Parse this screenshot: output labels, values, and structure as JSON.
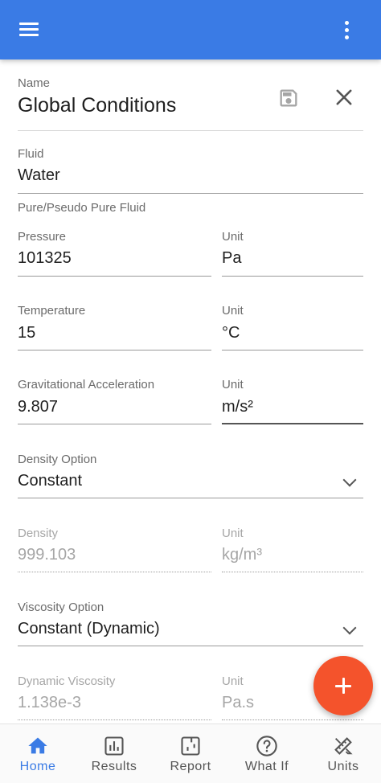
{
  "appbar": {
    "menu_icon": "hamburger-menu-icon",
    "more_icon": "more-vert-icon"
  },
  "name_field": {
    "label": "Name",
    "value": "Global Conditions"
  },
  "fluid_field": {
    "label": "Fluid",
    "value": "Water",
    "subtitle": "Pure/Pseudo Pure Fluid"
  },
  "pressure": {
    "label": "Pressure",
    "value": "101325",
    "unit_label": "Unit",
    "unit": "Pa"
  },
  "temperature": {
    "label": "Temperature",
    "value": "15",
    "unit_label": "Unit",
    "unit": "°C"
  },
  "gravity": {
    "label": "Gravitational Acceleration",
    "value": "9.807",
    "unit_label": "Unit",
    "unit": "m/s²"
  },
  "density_option": {
    "label": "Density Option",
    "value": "Constant"
  },
  "density": {
    "label": "Density",
    "value": "999.103",
    "unit_label": "Unit",
    "unit": "kg/m³"
  },
  "viscosity_option": {
    "label": "Viscosity Option",
    "value": "Constant (Dynamic)"
  },
  "viscosity": {
    "label": "Dynamic Viscosity",
    "value": "1.138e-3",
    "unit_label": "Unit",
    "unit": "Pa.s"
  },
  "colors": {
    "primary": "#3a7be5",
    "fab": "#f4532c"
  },
  "bottom_nav": {
    "home": "Home",
    "results": "Results",
    "report": "Report",
    "whatif": "What If",
    "units": "Units"
  }
}
